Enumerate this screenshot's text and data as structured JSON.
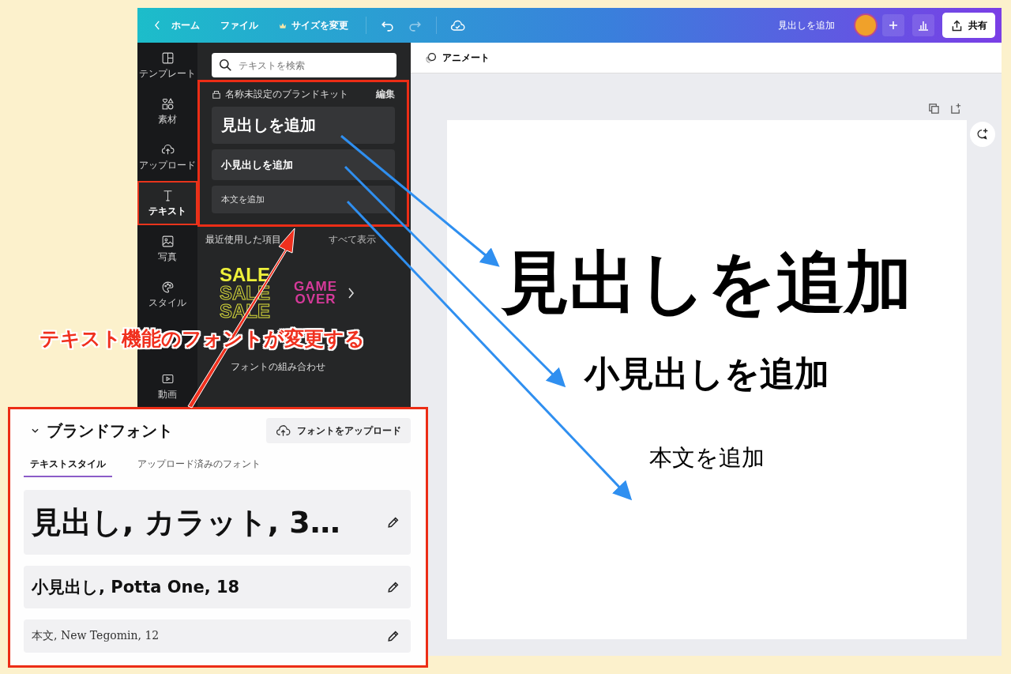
{
  "top_bar": {
    "back": "ホーム",
    "menu": [
      {
        "label": "ファイル",
        "kind": "plain"
      },
      {
        "label": "サイズを変更",
        "kind": "crown"
      }
    ],
    "design_title": "見出しを追加",
    "share": "共有"
  },
  "sidebar": {
    "items": [
      {
        "label": "テンプレート",
        "selected": false
      },
      {
        "label": "素材",
        "selected": false
      },
      {
        "label": "アップロード",
        "selected": false
      },
      {
        "label": "テキスト",
        "selected": true
      },
      {
        "label": "写真",
        "selected": false
      },
      {
        "label": "スタイル",
        "selected": false
      },
      {
        "label": "動画",
        "selected": false
      }
    ]
  },
  "text_panel": {
    "search": {
      "placeholder": "テキストを検索"
    },
    "brand_kit": {
      "title": "名称未設定のブランドキット",
      "edit": "編集",
      "styles": [
        {
          "kind": "heading",
          "text": "見出しを追加"
        },
        {
          "kind": "subheading",
          "text": "小見出しを追加"
        },
        {
          "kind": "body",
          "text": "本文を追加"
        }
      ]
    },
    "recent": {
      "title": "最近使用した項目",
      "show_all": "すべて表示",
      "thumbnails": [
        {
          "kind": "sale",
          "lines": [
            "SALE",
            "SALE",
            "SALE"
          ]
        },
        {
          "kind": "game",
          "lines": [
            "GAME",
            "OVER"
          ]
        }
      ]
    },
    "font_combos": "フォントの組み合わせ"
  },
  "canvas": {
    "toolbar": "アニメート",
    "texts": [
      {
        "kind": "heading",
        "text": "見出しを追加"
      },
      {
        "kind": "subheading",
        "text": "小見出しを追加"
      },
      {
        "kind": "body",
        "text": "本文を追加"
      }
    ]
  },
  "brand_fonts": {
    "title": "ブランドフォント",
    "upload": "フォントをアップロード",
    "tabs": [
      {
        "label": "テキストスタイル",
        "selected": true
      },
      {
        "label": "アップロード済みのフォント",
        "selected": false
      }
    ],
    "styles": [
      {
        "kind": "heading",
        "text": "見出し, カラット, 3…"
      },
      {
        "kind": "subheading",
        "text": "小見出し, Potta One, 18"
      },
      {
        "kind": "body",
        "text": "本文, New Tegomin, 12"
      }
    ]
  },
  "annotation": {
    "label": "テキスト機能のフォントが変更する"
  }
}
